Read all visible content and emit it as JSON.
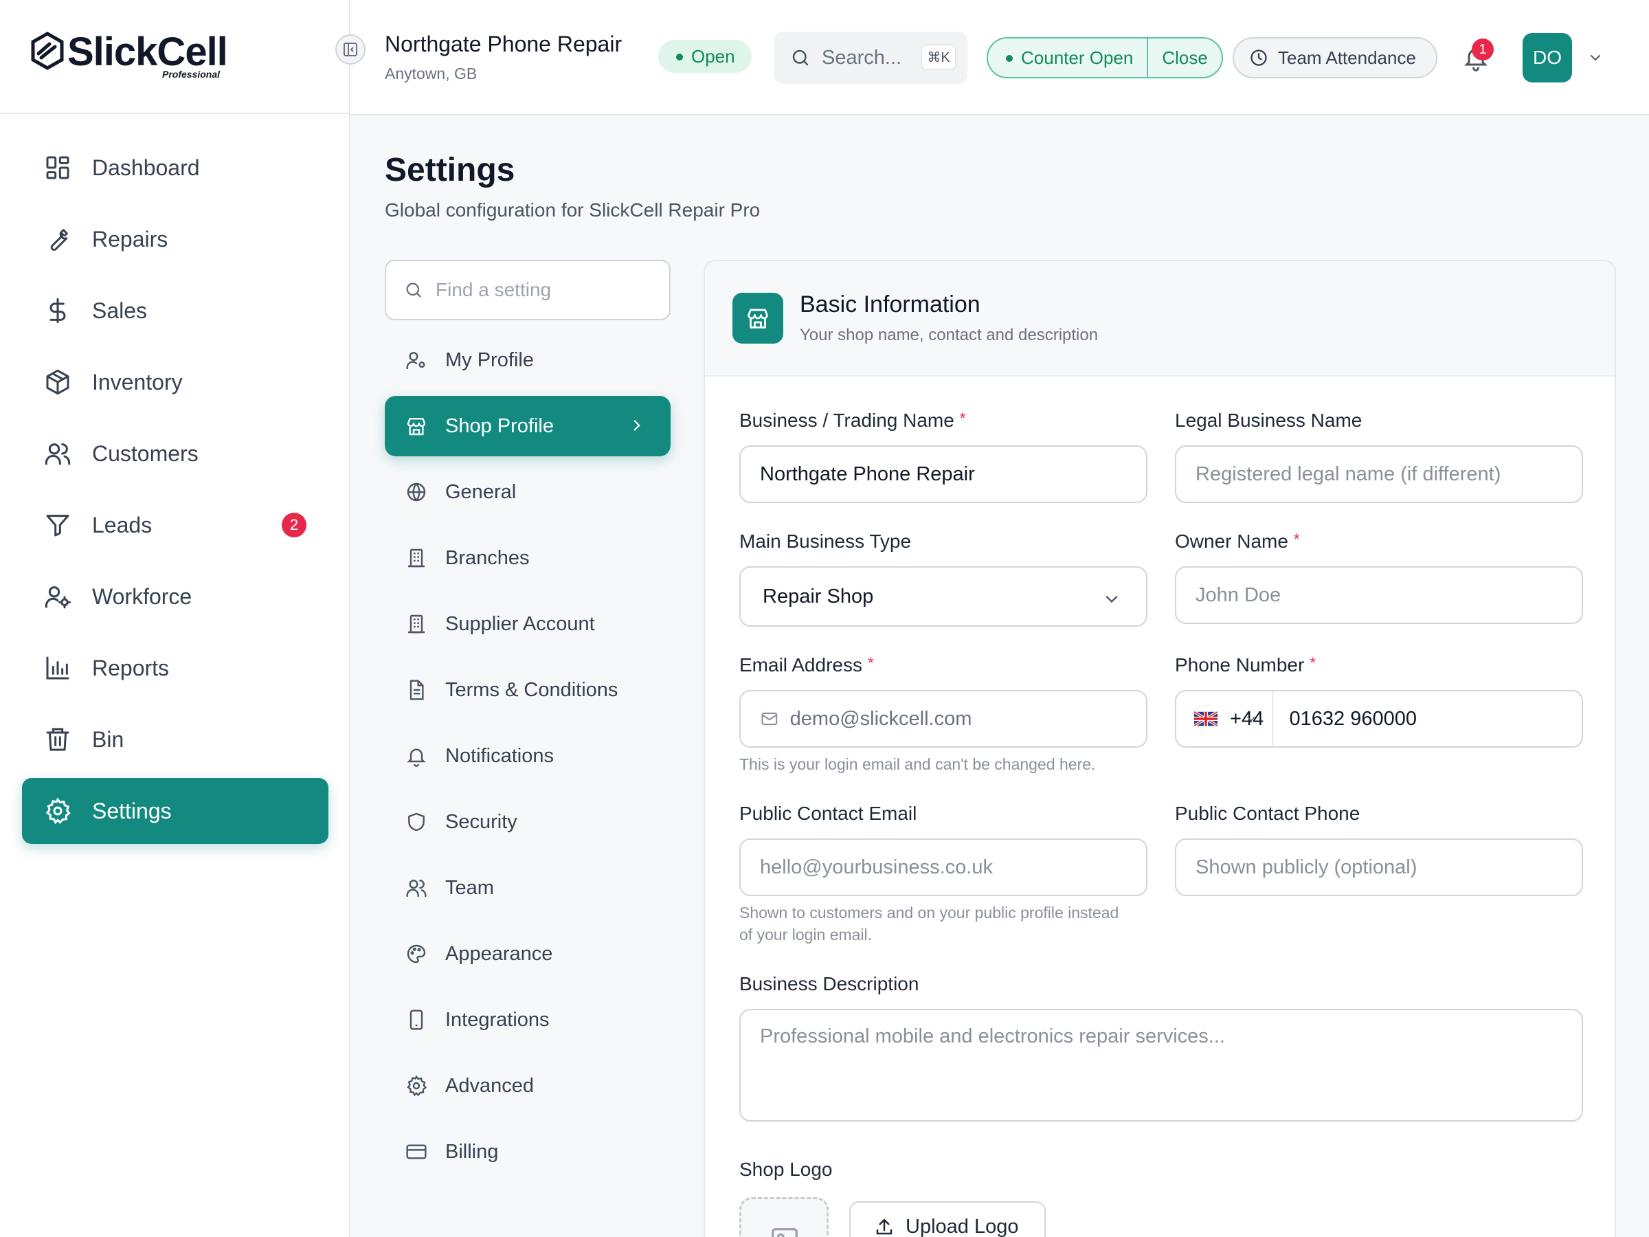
{
  "brand": {
    "name": "SlickCell",
    "edition": "Professional"
  },
  "sidebar": {
    "items": [
      {
        "label": "Dashboard",
        "icon": "dashboard-icon"
      },
      {
        "label": "Repairs",
        "icon": "wrench-icon"
      },
      {
        "label": "Sales",
        "icon": "dollar-icon"
      },
      {
        "label": "Inventory",
        "icon": "box-icon"
      },
      {
        "label": "Customers",
        "icon": "users-icon"
      },
      {
        "label": "Leads",
        "icon": "filter-icon",
        "badge": "2"
      },
      {
        "label": "Workforce",
        "icon": "user-gear-icon"
      },
      {
        "label": "Reports",
        "icon": "bar-chart-icon"
      },
      {
        "label": "Bin",
        "icon": "trash-icon"
      },
      {
        "label": "Settings",
        "icon": "gear-icon",
        "active": true
      }
    ]
  },
  "header": {
    "shop_name": "Northgate Phone Repair",
    "shop_location": "Anytown, GB",
    "status": "Open",
    "search_label": "Search...",
    "search_shortcut": "⌘K",
    "counter_status": "Counter Open",
    "counter_close": "Close",
    "attendance_label": "Team Attendance",
    "notifications_count": "1",
    "avatar_initials": "DO"
  },
  "page": {
    "title": "Settings",
    "subtitle": "Global configuration for SlickCell Repair Pro"
  },
  "settings_nav": {
    "search_placeholder": "Find a setting",
    "items": [
      {
        "label": "My Profile",
        "icon": "user-gear-icon"
      },
      {
        "label": "Shop Profile",
        "icon": "store-icon",
        "active": true
      },
      {
        "label": "General",
        "icon": "globe-icon"
      },
      {
        "label": "Branches",
        "icon": "building-icon"
      },
      {
        "label": "Supplier Account",
        "icon": "building-icon"
      },
      {
        "label": "Terms & Conditions",
        "icon": "document-icon"
      },
      {
        "label": "Notifications",
        "icon": "bell-icon"
      },
      {
        "label": "Security",
        "icon": "shield-icon"
      },
      {
        "label": "Team",
        "icon": "users-icon"
      },
      {
        "label": "Appearance",
        "icon": "palette-icon"
      },
      {
        "label": "Integrations",
        "icon": "tablet-icon"
      },
      {
        "label": "Advanced",
        "icon": "gear-icon"
      },
      {
        "label": "Billing",
        "icon": "credit-card-icon"
      }
    ]
  },
  "card": {
    "title": "Basic Information",
    "subtitle": "Your shop name, contact and description",
    "fields": {
      "trading_name": {
        "label": "Business / Trading Name",
        "required": "*",
        "value": "Northgate Phone Repair"
      },
      "legal_name": {
        "label": "Legal Business Name",
        "placeholder": "Registered legal name (if different)"
      },
      "business_type": {
        "label": "Main Business Type",
        "value": "Repair Shop"
      },
      "owner_name": {
        "label": "Owner Name",
        "required": "*",
        "placeholder": "John Doe"
      },
      "email": {
        "label": "Email Address",
        "required": "*",
        "value": "demo@slickcell.com",
        "hint": "This is your login email and can't be changed here."
      },
      "phone": {
        "label": "Phone Number",
        "required": "*",
        "country_code": "+44",
        "value": "01632 960000"
      },
      "public_email": {
        "label": "Public Contact Email",
        "placeholder": "hello@yourbusiness.co.uk",
        "hint": "Shown to customers and on your public profile instead of your login email."
      },
      "public_phone": {
        "label": "Public Contact Phone",
        "placeholder": "Shown publicly (optional)"
      },
      "description": {
        "label": "Business Description",
        "placeholder": "Professional mobile and electronics repair services..."
      },
      "logo": {
        "label": "Shop Logo",
        "button": "Upload Logo"
      }
    }
  },
  "colors": {
    "accent": "#128a80",
    "badge": "#e8284a",
    "status_green": "#128a5a"
  }
}
